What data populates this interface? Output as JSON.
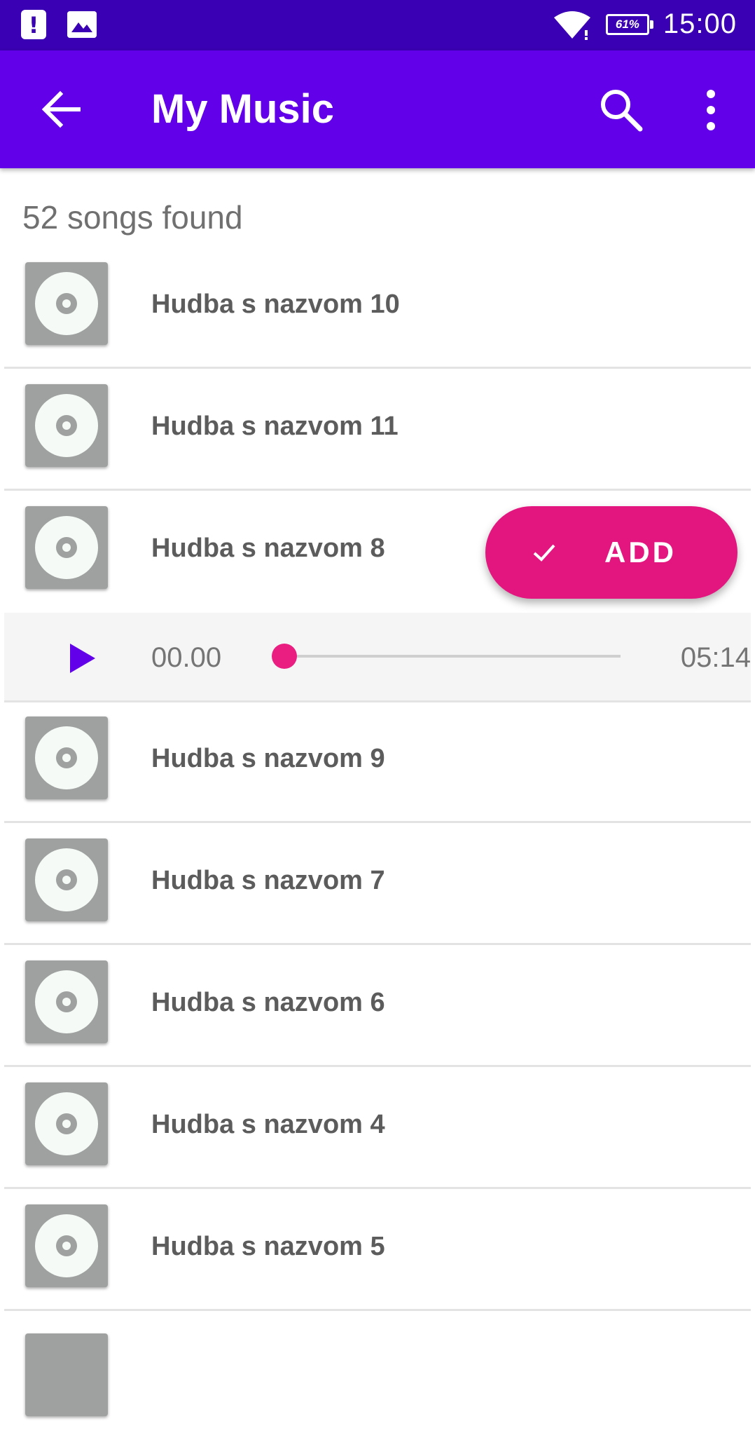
{
  "status_bar": {
    "battery_level": "61%",
    "time": "15:00",
    "icons": [
      "alert-icon",
      "image-icon",
      "wifi-icon",
      "battery-icon"
    ]
  },
  "app_bar": {
    "title": "My Music",
    "icons": [
      "back-arrow-icon",
      "search-icon",
      "more-vert-icon"
    ]
  },
  "count_text": "52 songs found",
  "songs": [
    {
      "title": "Hudba s nazvom 10"
    },
    {
      "title": "Hudba s nazvom 11"
    },
    {
      "title": "Hudba s nazvom 8"
    },
    {
      "title": "Hudba s nazvom 9"
    },
    {
      "title": "Hudba s nazvom 7"
    },
    {
      "title": "Hudba s nazvom 6"
    },
    {
      "title": "Hudba s nazvom 4"
    },
    {
      "title": "Hudba s nazvom 5"
    }
  ],
  "player": {
    "current_time": "00.00",
    "total_time": "05:14",
    "progress": 0.0,
    "icon": "play-icon"
  },
  "fab": {
    "label": "ADD",
    "icon": "check-icon"
  },
  "colors": {
    "status_bar": "#3a00b3",
    "app_bar": "#6200ea",
    "accent": "#e3167f",
    "play": "#6200ea",
    "text_secondary": "#707070"
  }
}
